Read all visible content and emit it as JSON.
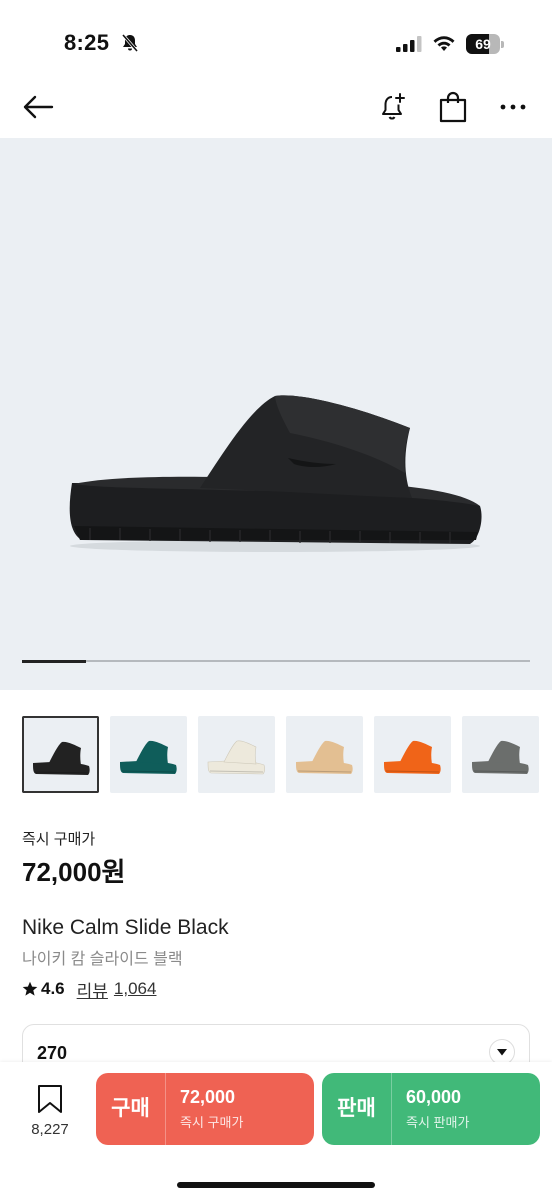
{
  "status_bar": {
    "time": "8:25",
    "battery_level": "69",
    "icons": [
      "bell-slash-icon",
      "signal-icon",
      "wifi-icon",
      "battery-icon"
    ]
  },
  "header": {
    "icons": [
      "back-arrow-icon",
      "bell-plus-icon",
      "shopping-bag-icon",
      "more-dots-icon"
    ]
  },
  "gallery": {
    "progress_fraction": 0.125,
    "thumbnails": [
      {
        "color": "#222222",
        "selected": true
      },
      {
        "color": "#0f5d5a",
        "selected": false
      },
      {
        "color": "#ede9dc",
        "selected": false
      },
      {
        "color": "#e3bf92",
        "selected": false
      },
      {
        "color": "#f06418",
        "selected": false
      },
      {
        "color": "#6b6e6c",
        "selected": false
      }
    ]
  },
  "product": {
    "price_label": "즉시 구매가",
    "price": "72,000원",
    "name_en": "Nike Calm Slide Black",
    "name_ko": "나이키 캄 슬라이드 블랙",
    "rating": "4.6",
    "review_label": "리뷰",
    "review_count": "1,064"
  },
  "size_selector": {
    "value": "270"
  },
  "bottom_bar": {
    "wish_count": "8,227",
    "buy": {
      "label": "구매",
      "price": "72,000",
      "sub": "즉시 구매가",
      "color": "#ef6253"
    },
    "sell": {
      "label": "판매",
      "price": "60,000",
      "sub": "즉시 판매가",
      "color": "#41b979"
    }
  }
}
